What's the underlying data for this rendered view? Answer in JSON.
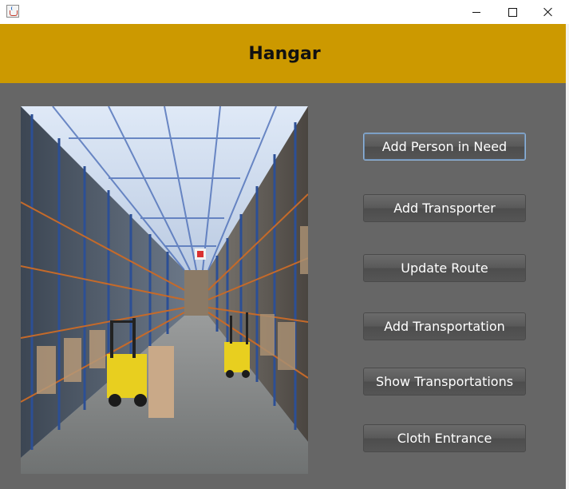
{
  "header": {
    "title": "Hangar"
  },
  "image": {
    "alt": "warehouse"
  },
  "buttons": [
    {
      "label": "Add Person in Need"
    },
    {
      "label": "Add Transporter"
    },
    {
      "label": "Update Route"
    },
    {
      "label": "Add Transportation"
    },
    {
      "label": "Show Transportations"
    },
    {
      "label": "Cloth Entrance"
    }
  ],
  "colors": {
    "header": "#cc9900",
    "background": "#666666",
    "button": "#5a5a5a",
    "focus_border": "#8fb3d9"
  }
}
